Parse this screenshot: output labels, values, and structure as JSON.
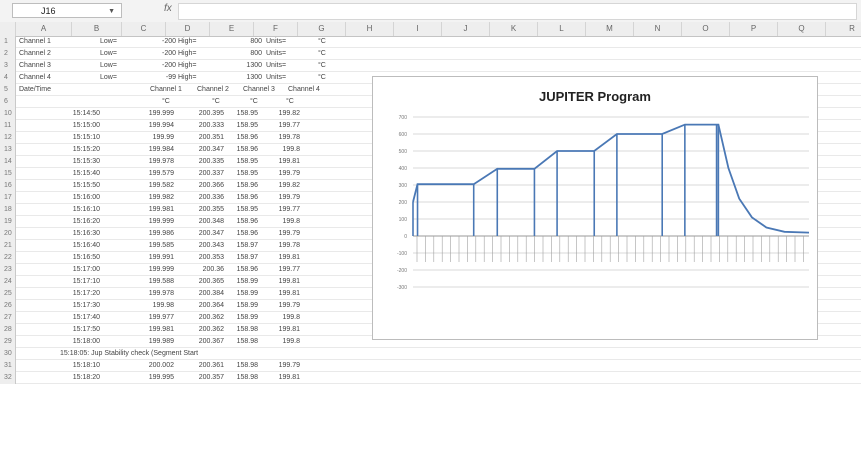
{
  "formula_bar": {
    "name_box": "J16",
    "fx": "fx"
  },
  "columns": [
    "A",
    "B",
    "C",
    "D",
    "E",
    "F",
    "G",
    "H",
    "I",
    "J",
    "K",
    "L",
    "M",
    "N",
    "O",
    "P",
    "Q",
    "R"
  ],
  "channel_rows": [
    {
      "row": "1",
      "name": "Channel 1",
      "low": "Low=",
      "low_val": "-200",
      "high": "High=",
      "high_val": "800",
      "units": "Units=",
      "unit": "°C"
    },
    {
      "row": "2",
      "name": "Channel 2",
      "low": "Low=",
      "low_val": "-200",
      "high": "High=",
      "high_val": "800",
      "units": "Units=",
      "unit": "°C"
    },
    {
      "row": "3",
      "name": "Channel 3",
      "low": "Low=",
      "low_val": "-200",
      "high": "High=",
      "high_val": "1300",
      "units": "Units=",
      "unit": "°C"
    },
    {
      "row": "4",
      "name": "Channel 4",
      "low": "Low=",
      "low_val": "-99",
      "high": "High=",
      "high_val": "1300",
      "units": "Units=",
      "unit": "°C"
    }
  ],
  "header_row": {
    "row": "5",
    "a": "Date/Time",
    "c": "Channel 1",
    "d": "Channel 2",
    "e": "Channel 3",
    "f": "Channel 4"
  },
  "units_row": {
    "row": "6",
    "c": "°C",
    "d": "°C",
    "e": "°C",
    "f": "°C"
  },
  "data_rows": [
    {
      "row": "10",
      "t": "15:14:50",
      "v": [
        "199.999",
        "200.395",
        "158.95",
        "199.82"
      ]
    },
    {
      "row": "11",
      "t": "15:15:00",
      "v": [
        "199.994",
        "200.333",
        "158.95",
        "199.77"
      ]
    },
    {
      "row": "12",
      "t": "15:15:10",
      "v": [
        "199.99",
        "200.351",
        "158.96",
        "199.78"
      ]
    },
    {
      "row": "13",
      "t": "15:15:20",
      "v": [
        "199.984",
        "200.347",
        "158.96",
        "199.8"
      ]
    },
    {
      "row": "14",
      "t": "15:15:30",
      "v": [
        "199.978",
        "200.335",
        "158.95",
        "199.81"
      ]
    },
    {
      "row": "15",
      "t": "15:15:40",
      "v": [
        "199.579",
        "200.337",
        "158.95",
        "199.79"
      ]
    },
    {
      "row": "16",
      "t": "15:15:50",
      "v": [
        "199.582",
        "200.366",
        "158.96",
        "199.82"
      ]
    },
    {
      "row": "17",
      "t": "15:16:00",
      "v": [
        "199.982",
        "200.336",
        "158.96",
        "199.79"
      ]
    },
    {
      "row": "18",
      "t": "15:16:10",
      "v": [
        "199.981",
        "200.355",
        "158.95",
        "199.77"
      ]
    },
    {
      "row": "19",
      "t": "15:16:20",
      "v": [
        "199.999",
        "200.348",
        "158.96",
        "199.8"
      ]
    },
    {
      "row": "20",
      "t": "15:16:30",
      "v": [
        "199.986",
        "200.347",
        "158.96",
        "199.79"
      ]
    },
    {
      "row": "21",
      "t": "15:16:40",
      "v": [
        "199.585",
        "200.343",
        "158.97",
        "199.78"
      ]
    },
    {
      "row": "22",
      "t": "15:16:50",
      "v": [
        "199.991",
        "200.353",
        "158.97",
        "199.81"
      ]
    },
    {
      "row": "23",
      "t": "15:17:00",
      "v": [
        "199.999",
        "200.36",
        "158.96",
        "199.77"
      ]
    },
    {
      "row": "24",
      "t": "15:17:10",
      "v": [
        "199.588",
        "200.365",
        "158.99",
        "199.81"
      ]
    },
    {
      "row": "25",
      "t": "15:17:20",
      "v": [
        "199.978",
        "200.384",
        "158.99",
        "199.81"
      ]
    },
    {
      "row": "26",
      "t": "15:17:30",
      "v": [
        "199.98",
        "200.364",
        "158.99",
        "199.79"
      ]
    },
    {
      "row": "27",
      "t": "15:17:40",
      "v": [
        "199.977",
        "200.362",
        "158.99",
        "199.8"
      ]
    },
    {
      "row": "28",
      "t": "15:17:50",
      "v": [
        "199.981",
        "200.362",
        "158.98",
        "199.81"
      ]
    },
    {
      "row": "29",
      "t": "15:18:00",
      "v": [
        "199.989",
        "200.367",
        "158.98",
        "199.8"
      ]
    }
  ],
  "note_row": {
    "row": "30",
    "text": "15:18:05: Jup Stability check (Segment Start"
  },
  "tail_rows": [
    {
      "row": "31",
      "t": "15:18:10",
      "v": [
        "200.002",
        "200.361",
        "158.98",
        "199.79"
      ]
    },
    {
      "row": "32",
      "t": "15:18:20",
      "v": [
        "199.995",
        "200.357",
        "158.98",
        "199.81"
      ]
    }
  ],
  "chart": {
    "title": "JUPITER Program",
    "y_ticks": [
      "700",
      "600",
      "500",
      "400",
      "300",
      "200",
      "100",
      "0",
      "-100",
      "-200",
      "-300"
    ],
    "line_color": "#4a78b5",
    "chart_data": {
      "type": "line",
      "title": "JUPITER Program",
      "ylim": [
        -300,
        700
      ],
      "profile": [
        [
          0,
          200
        ],
        [
          5,
          305
        ],
        [
          67,
          305
        ],
        [
          93,
          395
        ],
        [
          134,
          395
        ],
        [
          159,
          500
        ],
        [
          200,
          500
        ],
        [
          225,
          600
        ],
        [
          275,
          600
        ],
        [
          300,
          655
        ],
        [
          337,
          655
        ],
        [
          348,
          400
        ],
        [
          360,
          220
        ],
        [
          374,
          110
        ],
        [
          390,
          50
        ],
        [
          410,
          25
        ],
        [
          437,
          20
        ]
      ],
      "bars": [
        0,
        5,
        67,
        93,
        134,
        159,
        200,
        225,
        275,
        300,
        335,
        337
      ]
    }
  }
}
